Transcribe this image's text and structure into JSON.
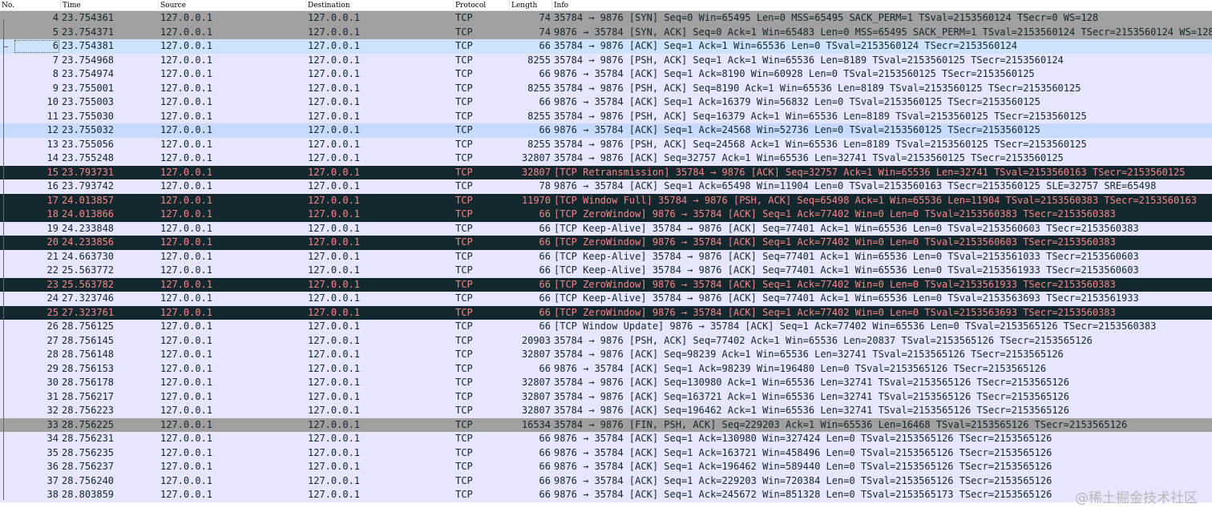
{
  "columns": {
    "no": "No.",
    "time": "Time",
    "source": "Source",
    "destination": "Destination",
    "protocol": "Protocol",
    "length": "Length",
    "info": "Info"
  },
  "colors": {
    "tcp_row": "#e7e6ff",
    "syn_fin_row": "#a0a0a0",
    "bad_tcp_row_bg": "#12272e",
    "bad_tcp_row_fg": "#f78787",
    "selected_row": "#cde3ff"
  },
  "packets": [
    {
      "no": "4",
      "time": "23.754361",
      "src": "127.0.0.1",
      "dst": "127.0.0.1",
      "proto": "TCP",
      "len": "74",
      "info": "35784 → 9876 [SYN] Seq=0 Win=65495 Len=0 MSS=65495 SACK_PERM=1 TSval=2153560124 TSecr=0 WS=128",
      "style": "syn"
    },
    {
      "no": "5",
      "time": "23.754371",
      "src": "127.0.0.1",
      "dst": "127.0.0.1",
      "proto": "TCP",
      "len": "74",
      "info": "9876 → 35784 [SYN, ACK] Seq=0 Ack=1 Win=65483 Len=0 MSS=65495 SACK_PERM=1 TSval=2153560124 TSecr=2153560124 WS=128",
      "style": "syn"
    },
    {
      "no": "6",
      "time": "23.754381",
      "src": "127.0.0.1",
      "dst": "127.0.0.1",
      "proto": "TCP",
      "len": "66",
      "info": "35784 → 9876 [ACK] Seq=1 Ack=1 Win=65536 Len=0 TSval=2153560124 TSecr=2153560124",
      "style": "selected"
    },
    {
      "no": "7",
      "time": "23.754968",
      "src": "127.0.0.1",
      "dst": "127.0.0.1",
      "proto": "TCP",
      "len": "8255",
      "info": "35784 → 9876 [PSH, ACK] Seq=1 Ack=1 Win=65536 Len=8189 TSval=2153560125 TSecr=2153560124",
      "style": "tcp"
    },
    {
      "no": "8",
      "time": "23.754974",
      "src": "127.0.0.1",
      "dst": "127.0.0.1",
      "proto": "TCP",
      "len": "66",
      "info": "9876 → 35784 [ACK] Seq=1 Ack=8190 Win=60928 Len=0 TSval=2153560125 TSecr=2153560125",
      "style": "tcp"
    },
    {
      "no": "9",
      "time": "23.755001",
      "src": "127.0.0.1",
      "dst": "127.0.0.1",
      "proto": "TCP",
      "len": "8255",
      "info": "35784 → 9876 [PSH, ACK] Seq=8190 Ack=1 Win=65536 Len=8189 TSval=2153560125 TSecr=2153560125",
      "style": "tcp"
    },
    {
      "no": "10",
      "time": "23.755003",
      "src": "127.0.0.1",
      "dst": "127.0.0.1",
      "proto": "TCP",
      "len": "66",
      "info": "9876 → 35784 [ACK] Seq=1 Ack=16379 Win=56832 Len=0 TSval=2153560125 TSecr=2153560125",
      "style": "tcp"
    },
    {
      "no": "11",
      "time": "23.755030",
      "src": "127.0.0.1",
      "dst": "127.0.0.1",
      "proto": "TCP",
      "len": "8255",
      "info": "35784 → 9876 [PSH, ACK] Seq=16379 Ack=1 Win=65536 Len=8189 TSval=2153560125 TSecr=2153560125",
      "style": "tcp"
    },
    {
      "no": "12",
      "time": "23.755032",
      "src": "127.0.0.1",
      "dst": "127.0.0.1",
      "proto": "TCP",
      "len": "66",
      "info": "9876 → 35784 [ACK] Seq=1 Ack=24568 Win=52736 Len=0 TSval=2153560125 TSecr=2153560125",
      "style": "current"
    },
    {
      "no": "13",
      "time": "23.755056",
      "src": "127.0.0.1",
      "dst": "127.0.0.1",
      "proto": "TCP",
      "len": "8255",
      "info": "35784 → 9876 [PSH, ACK] Seq=24568 Ack=1 Win=65536 Len=8189 TSval=2153560125 TSecr=2153560125",
      "style": "tcp"
    },
    {
      "no": "14",
      "time": "23.755248",
      "src": "127.0.0.1",
      "dst": "127.0.0.1",
      "proto": "TCP",
      "len": "32807",
      "info": "35784 → 9876 [ACK] Seq=32757 Ack=1 Win=65536 Len=32741 TSval=2153560125 TSecr=2153560125",
      "style": "tcp"
    },
    {
      "no": "15",
      "time": "23.793731",
      "src": "127.0.0.1",
      "dst": "127.0.0.1",
      "proto": "TCP",
      "len": "32807",
      "info": "[TCP Retransmission] 35784 → 9876 [ACK] Seq=32757 Ack=1 Win=65536 Len=32741 TSval=2153560163 TSecr=2153560125",
      "style": "bad"
    },
    {
      "no": "16",
      "time": "23.793742",
      "src": "127.0.0.1",
      "dst": "127.0.0.1",
      "proto": "TCP",
      "len": "78",
      "info": "9876 → 35784 [ACK] Seq=1 Ack=65498 Win=11904 Len=0 TSval=2153560163 TSecr=2153560125 SLE=32757 SRE=65498",
      "style": "tcp"
    },
    {
      "no": "17",
      "time": "24.013857",
      "src": "127.0.0.1",
      "dst": "127.0.0.1",
      "proto": "TCP",
      "len": "11970",
      "info": "[TCP Window Full] 35784 → 9876 [PSH, ACK] Seq=65498 Ack=1 Win=65536 Len=11904 TSval=2153560383 TSecr=2153560163",
      "style": "bad"
    },
    {
      "no": "18",
      "time": "24.013866",
      "src": "127.0.0.1",
      "dst": "127.0.0.1",
      "proto": "TCP",
      "len": "66",
      "info": "[TCP ZeroWindow] 9876 → 35784 [ACK] Seq=1 Ack=77402 Win=0 Len=0 TSval=2153560383 TSecr=2153560383",
      "style": "bad"
    },
    {
      "no": "19",
      "time": "24.233848",
      "src": "127.0.0.1",
      "dst": "127.0.0.1",
      "proto": "TCP",
      "len": "66",
      "info": "[TCP Keep-Alive] 35784 → 9876 [ACK] Seq=77401 Ack=1 Win=65536 Len=0 TSval=2153560603 TSecr=2153560383",
      "style": "tcp"
    },
    {
      "no": "20",
      "time": "24.233856",
      "src": "127.0.0.1",
      "dst": "127.0.0.1",
      "proto": "TCP",
      "len": "66",
      "info": "[TCP ZeroWindow] 9876 → 35784 [ACK] Seq=1 Ack=77402 Win=0 Len=0 TSval=2153560603 TSecr=2153560383",
      "style": "bad"
    },
    {
      "no": "21",
      "time": "24.663730",
      "src": "127.0.0.1",
      "dst": "127.0.0.1",
      "proto": "TCP",
      "len": "66",
      "info": "[TCP Keep-Alive] 35784 → 9876 [ACK] Seq=77401 Ack=1 Win=65536 Len=0 TSval=2153561033 TSecr=2153560603",
      "style": "tcp"
    },
    {
      "no": "22",
      "time": "25.563772",
      "src": "127.0.0.1",
      "dst": "127.0.0.1",
      "proto": "TCP",
      "len": "66",
      "info": "[TCP Keep-Alive] 35784 → 9876 [ACK] Seq=77401 Ack=1 Win=65536 Len=0 TSval=2153561933 TSecr=2153560603",
      "style": "tcp"
    },
    {
      "no": "23",
      "time": "25.563782",
      "src": "127.0.0.1",
      "dst": "127.0.0.1",
      "proto": "TCP",
      "len": "66",
      "info": "[TCP ZeroWindow] 9876 → 35784 [ACK] Seq=1 Ack=77402 Win=0 Len=0 TSval=2153561933 TSecr=2153560383",
      "style": "bad"
    },
    {
      "no": "24",
      "time": "27.323746",
      "src": "127.0.0.1",
      "dst": "127.0.0.1",
      "proto": "TCP",
      "len": "66",
      "info": "[TCP Keep-Alive] 35784 → 9876 [ACK] Seq=77401 Ack=1 Win=65536 Len=0 TSval=2153563693 TSecr=2153561933",
      "style": "tcp"
    },
    {
      "no": "25",
      "time": "27.323761",
      "src": "127.0.0.1",
      "dst": "127.0.0.1",
      "proto": "TCP",
      "len": "66",
      "info": "[TCP ZeroWindow] 9876 → 35784 [ACK] Seq=1 Ack=77402 Win=0 Len=0 TSval=2153563693 TSecr=2153560383",
      "style": "bad"
    },
    {
      "no": "26",
      "time": "28.756125",
      "src": "127.0.0.1",
      "dst": "127.0.0.1",
      "proto": "TCP",
      "len": "66",
      "info": "[TCP Window Update] 9876 → 35784 [ACK] Seq=1 Ack=77402 Win=65536 Len=0 TSval=2153565126 TSecr=2153560383",
      "style": "tcp"
    },
    {
      "no": "27",
      "time": "28.756145",
      "src": "127.0.0.1",
      "dst": "127.0.0.1",
      "proto": "TCP",
      "len": "20903",
      "info": "35784 → 9876 [PSH, ACK] Seq=77402 Ack=1 Win=65536 Len=20837 TSval=2153565126 TSecr=2153565126",
      "style": "tcp"
    },
    {
      "no": "28",
      "time": "28.756148",
      "src": "127.0.0.1",
      "dst": "127.0.0.1",
      "proto": "TCP",
      "len": "32807",
      "info": "35784 → 9876 [ACK] Seq=98239 Ack=1 Win=65536 Len=32741 TSval=2153565126 TSecr=2153565126",
      "style": "tcp"
    },
    {
      "no": "29",
      "time": "28.756153",
      "src": "127.0.0.1",
      "dst": "127.0.0.1",
      "proto": "TCP",
      "len": "66",
      "info": "9876 → 35784 [ACK] Seq=1 Ack=98239 Win=196480 Len=0 TSval=2153565126 TSecr=2153565126",
      "style": "tcp"
    },
    {
      "no": "30",
      "time": "28.756178",
      "src": "127.0.0.1",
      "dst": "127.0.0.1",
      "proto": "TCP",
      "len": "32807",
      "info": "35784 → 9876 [ACK] Seq=130980 Ack=1 Win=65536 Len=32741 TSval=2153565126 TSecr=2153565126",
      "style": "tcp"
    },
    {
      "no": "31",
      "time": "28.756217",
      "src": "127.0.0.1",
      "dst": "127.0.0.1",
      "proto": "TCP",
      "len": "32807",
      "info": "35784 → 9876 [ACK] Seq=163721 Ack=1 Win=65536 Len=32741 TSval=2153565126 TSecr=2153565126",
      "style": "tcp"
    },
    {
      "no": "32",
      "time": "28.756223",
      "src": "127.0.0.1",
      "dst": "127.0.0.1",
      "proto": "TCP",
      "len": "32807",
      "info": "35784 → 9876 [ACK] Seq=196462 Ack=1 Win=65536 Len=32741 TSval=2153565126 TSecr=2153565126",
      "style": "tcp"
    },
    {
      "no": "33",
      "time": "28.756225",
      "src": "127.0.0.1",
      "dst": "127.0.0.1",
      "proto": "TCP",
      "len": "16534",
      "info": "35784 → 9876 [FIN, PSH, ACK] Seq=229203 Ack=1 Win=65536 Len=16468 TSval=2153565126 TSecr=2153565126",
      "style": "fin"
    },
    {
      "no": "34",
      "time": "28.756231",
      "src": "127.0.0.1",
      "dst": "127.0.0.1",
      "proto": "TCP",
      "len": "66",
      "info": "9876 → 35784 [ACK] Seq=1 Ack=130980 Win=327424 Len=0 TSval=2153565126 TSecr=2153565126",
      "style": "tcp"
    },
    {
      "no": "35",
      "time": "28.756235",
      "src": "127.0.0.1",
      "dst": "127.0.0.1",
      "proto": "TCP",
      "len": "66",
      "info": "9876 → 35784 [ACK] Seq=1 Ack=163721 Win=458496 Len=0 TSval=2153565126 TSecr=2153565126",
      "style": "tcp"
    },
    {
      "no": "36",
      "time": "28.756237",
      "src": "127.0.0.1",
      "dst": "127.0.0.1",
      "proto": "TCP",
      "len": "66",
      "info": "9876 → 35784 [ACK] Seq=1 Ack=196462 Win=589440 Len=0 TSval=2153565126 TSecr=2153565126",
      "style": "tcp"
    },
    {
      "no": "37",
      "time": "28.756240",
      "src": "127.0.0.1",
      "dst": "127.0.0.1",
      "proto": "TCP",
      "len": "66",
      "info": "9876 → 35784 [ACK] Seq=1 Ack=229203 Win=720384 Len=0 TSval=2153565126 TSecr=2153565126",
      "style": "tcp"
    },
    {
      "no": "38",
      "time": "28.803859",
      "src": "127.0.0.1",
      "dst": "127.0.0.1",
      "proto": "TCP",
      "len": "66",
      "info": "9876 → 35784 [ACK] Seq=1 Ack=245672 Win=851328 Len=0 TSval=2153565173 TSecr=2153565126",
      "style": "tcp"
    }
  ],
  "watermark": "@稀土掘金技术社区"
}
